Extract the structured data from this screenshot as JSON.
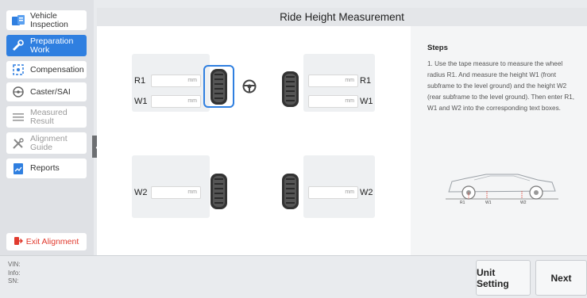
{
  "sidebar": {
    "items": [
      {
        "label": "Vehicle Inspection",
        "icon": "vehicle-inspection-icon"
      },
      {
        "label": "Preparation Work",
        "icon": "wrench-car-icon",
        "active": true
      },
      {
        "label": "Compensation",
        "icon": "compensation-icon"
      },
      {
        "label": "Caster/SAI",
        "icon": "steering-wheel-icon"
      },
      {
        "label": "Measured Result",
        "icon": "list-icon",
        "disabled": true
      },
      {
        "label": "Alignment Guide",
        "icon": "tools-icon",
        "disabled": true
      },
      {
        "label": "Reports",
        "icon": "report-icon"
      }
    ],
    "exit_label": "Exit Alignment"
  },
  "main": {
    "title": "Ride Height Measurement",
    "fields": {
      "front_left": {
        "r_label": "R1",
        "w_label": "W1",
        "unit": "mm"
      },
      "front_right": {
        "r_label": "R1",
        "w_label": "W1",
        "unit": "mm"
      },
      "rear_left": {
        "w_label": "W2",
        "unit": "mm"
      },
      "rear_right": {
        "w_label": "W2",
        "unit": "mm"
      }
    }
  },
  "steps": {
    "title": "Steps",
    "text": "1. Use the tape measure to measure the wheel radius R1. And measure the height W1 (front subframe to the level ground) and the height W2 (rear subframe to the level ground). Then enter R1, W1 and W2 into the corresponding text boxes.",
    "diagram_labels": [
      "R1",
      "W1",
      "W2"
    ]
  },
  "footer": {
    "vin_label": "VIN:",
    "info_label": "Info:",
    "sn_label": "SN:",
    "unit_setting": "Unit Setting",
    "next": "Next"
  },
  "colors": {
    "accent": "#2f7fe0",
    "exit": "#e13b2f"
  }
}
